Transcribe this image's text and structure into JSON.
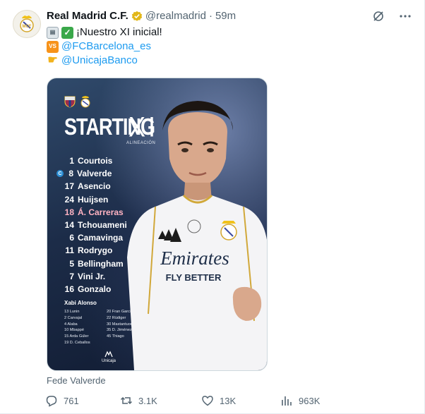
{
  "tweet": {
    "author_name": "Real Madrid C.F.",
    "handle": "@realmadrid",
    "separator": "·",
    "time": "59m",
    "lines": [
      {
        "emoji": [
          "clipboard-icon",
          "check-mark-icon"
        ],
        "text": "¡Nuestro XI inicial!"
      },
      {
        "emoji": [
          "vs-icon"
        ],
        "text": "@FCBarcelona_es"
      },
      {
        "emoji": [
          "pointing-hand-icon"
        ],
        "text": "@UnicajaBanco"
      }
    ]
  },
  "media": {
    "title_starting": "STARTING",
    "title_xi": "XI",
    "subtitle": "ALINEACIÓN",
    "players": [
      {
        "number": "1",
        "name": "Courtois",
        "captain": ""
      },
      {
        "number": "8",
        "name": "Valverde",
        "captain": "C"
      },
      {
        "number": "17",
        "name": "Asencio",
        "captain": ""
      },
      {
        "number": "24",
        "name": "Huijsen",
        "captain": ""
      },
      {
        "number": "18",
        "name": "Á. Carreras",
        "captain": ""
      },
      {
        "number": "14",
        "name": "Tchouameni",
        "captain": ""
      },
      {
        "number": "6",
        "name": "Camavinga",
        "captain": ""
      },
      {
        "number": "11",
        "name": "Rodrygo",
        "captain": ""
      },
      {
        "number": "5",
        "name": "Bellingham",
        "captain": ""
      },
      {
        "number": "7",
        "name": "Vini Jr.",
        "captain": ""
      },
      {
        "number": "16",
        "name": "Gonzalo",
        "captain": ""
      }
    ],
    "coach": "Xabi Alonso",
    "subs": [
      "13 Lunin",
      "20 Fran García",
      "2 Carvajal",
      "22 Rüdiger",
      "4 Alaba",
      "30 Mastantuono",
      "10 Mbappé",
      "35 D. Jiménez",
      "15 Arda Güler",
      "45 Thiago",
      "19 D. Ceballos",
      ""
    ],
    "sponsor": "Unicaja",
    "shirt_sponsor_line1": "Emirates",
    "shirt_sponsor_line2": "FLY BETTER"
  },
  "caption": "Fede Valverde",
  "actions": {
    "replies": "761",
    "reposts": "3.1K",
    "likes": "13K",
    "views": "963K"
  },
  "colors": {
    "link": "#1d9bf0",
    "muted": "#536471",
    "verified_gold": "#e2b719"
  }
}
